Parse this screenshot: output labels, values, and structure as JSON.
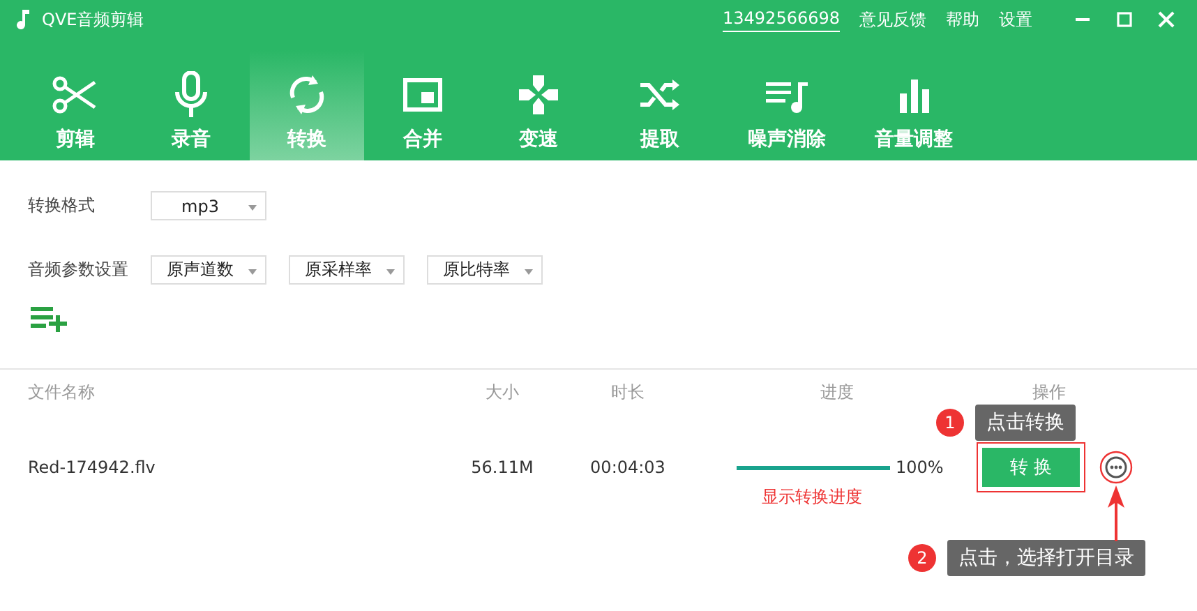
{
  "window": {
    "title": "QVE音频剪辑",
    "links": [
      "13492566698",
      "意见反馈",
      "帮助",
      "设置"
    ]
  },
  "tabs": [
    {
      "label": "剪辑",
      "selected": false
    },
    {
      "label": "录音",
      "selected": false
    },
    {
      "label": "转换",
      "selected": true
    },
    {
      "label": "合并",
      "selected": false
    },
    {
      "label": "变速",
      "selected": false
    },
    {
      "label": "提取",
      "selected": false
    },
    {
      "label": "噪声消除",
      "selected": false
    },
    {
      "label": "音量调整",
      "selected": false
    }
  ],
  "format": {
    "label": "转换格式",
    "value": "mp3"
  },
  "params": {
    "label": "音频参数设置",
    "selects": [
      "原声道数",
      "原采样率",
      "原比特率"
    ]
  },
  "table": {
    "columns": [
      "文件名称",
      "大小",
      "时长",
      "进度",
      "操作"
    ],
    "rows": [
      {
        "name": "Red-174942.flv",
        "size": "56.11M",
        "duration": "00:04:03",
        "level": 1,
        "percent": "100%",
        "button": "转 换"
      }
    ]
  },
  "annotations": {
    "progress_note": "显示转换进度",
    "callouts": [
      {
        "number": "1",
        "text": "点击转换"
      },
      {
        "number": "2",
        "text": "点击，选择打开目录"
      }
    ]
  }
}
